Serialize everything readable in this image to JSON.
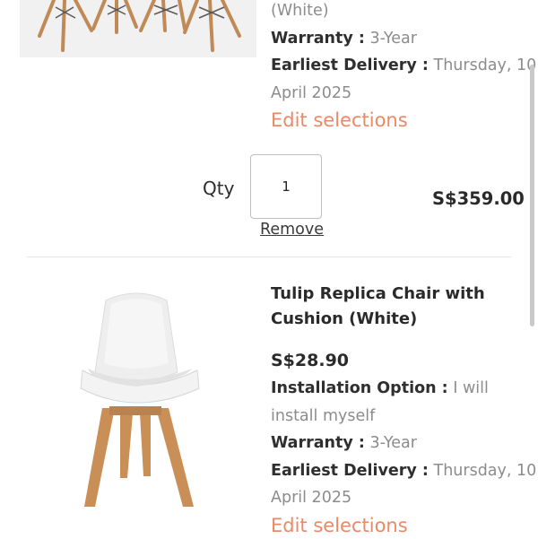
{
  "cart": {
    "items": [
      {
        "variant_tail": "(White)",
        "warranty": {
          "key": "Warranty :",
          "value": "3-Year"
        },
        "delivery": {
          "key": "Earliest Delivery :",
          "value_line1": "Thursday, 10",
          "value_line2": "April 2025"
        },
        "edit_label": "Edit selections",
        "qty_label": "Qty",
        "qty_value": "1",
        "remove_label": "Remove",
        "line_total": "S$359.00"
      },
      {
        "title_line1": "Tulip Replica Chair with",
        "title_line2": "Cushion (White)",
        "price": "S$28.90",
        "installation": {
          "key": "Installation Option :",
          "value_line1": "I will",
          "value_line2": "install myself"
        },
        "warranty": {
          "key": "Warranty :",
          "value": "3-Year"
        },
        "delivery": {
          "key": "Earliest Delivery :",
          "value_line1": "Thursday, 10",
          "value_line2": "April 2025"
        },
        "edit_label": "Edit selections"
      }
    ]
  },
  "colors": {
    "accent": "#e98a66",
    "muted": "#8c8c8c"
  }
}
